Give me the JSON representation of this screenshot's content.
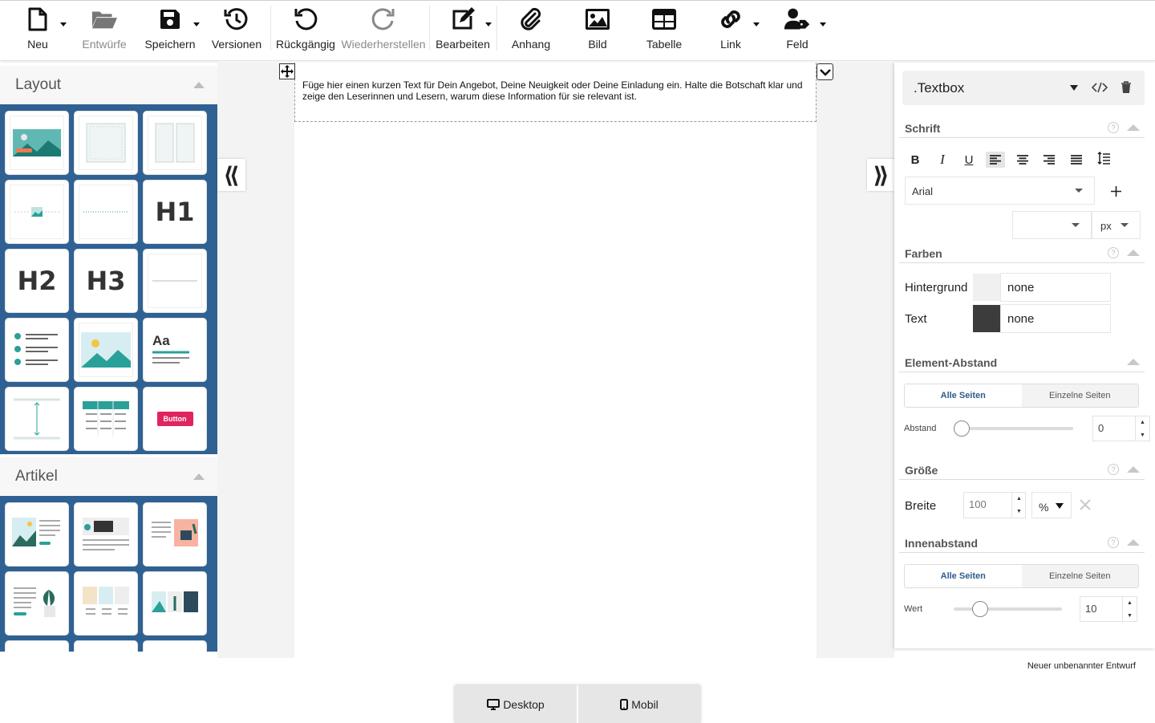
{
  "toolbar": {
    "items": [
      {
        "label": "Neu",
        "icon": "file-icon"
      },
      {
        "label": "Entwürfe",
        "icon": "folder-open-icon"
      },
      {
        "label": "Speichern",
        "icon": "save-icon"
      },
      {
        "label": "Versionen",
        "icon": "history-icon"
      },
      {
        "label": "Rückgängig",
        "icon": "undo-icon"
      },
      {
        "label": "Wiederherstellen",
        "icon": "redo-icon"
      },
      {
        "label": "Bearbeiten",
        "icon": "edit-icon"
      },
      {
        "label": "Anhang",
        "icon": "paperclip-icon"
      },
      {
        "label": "Bild",
        "icon": "image-icon"
      },
      {
        "label": "Tabelle",
        "icon": "table-icon"
      },
      {
        "label": "Link",
        "icon": "link-icon"
      },
      {
        "label": "Feld",
        "icon": "user-tag-icon"
      }
    ]
  },
  "left_panel": {
    "layout_title": "Layout",
    "articles_title": "Artikel",
    "tiles": {
      "h1": "H1",
      "h2": "H2",
      "h3": "H3",
      "typography": "Aa",
      "button": "Button"
    }
  },
  "canvas": {
    "textbox_text": "Füge hier einen kurzen Text für Dein Angebot, Deine Neuigkeit oder Deine Einladung ein. Halte die Botschaft klar und zeige den Leserinnen und Lesern, warum diese Information für sie relevant ist.",
    "collapse_left": "⟪",
    "collapse_right": "⟫"
  },
  "right_panel": {
    "element_type": ".Textbox",
    "sections": {
      "font": "Schrift",
      "colors": "Farben",
      "spacing": "Element-Abstand",
      "size": "Größe",
      "padding": "Innenabstand"
    },
    "font_family": "Arial",
    "font_size_unit": "px",
    "background_label": "Hintergrund",
    "background_value": "none",
    "text_label": "Text",
    "text_value": "none",
    "background_swatch": "#f0f0f0",
    "text_swatch": "#3c3c3c",
    "seg_all": "Alle Seiten",
    "seg_single": "Einzelne Seiten",
    "spacing_label": "Abstand",
    "spacing_value": "0",
    "width_label": "Breite",
    "width_value": "100",
    "width_unit": "%",
    "padding_label": "Wert",
    "padding_value": "10"
  },
  "footer": {
    "draft_name": "Neuer unbenannter Entwurf",
    "desktop": "Desktop",
    "mobile": "Mobil"
  }
}
